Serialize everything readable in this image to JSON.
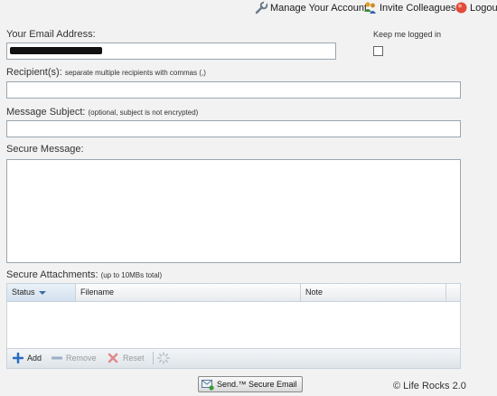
{
  "nav": {
    "manage_account": "Manage Your Account",
    "invite_colleagues": "Invite Colleagues",
    "logout": "Logout"
  },
  "email": {
    "label": "Your Email Address:",
    "value_redacted": true
  },
  "keep_logged_in": {
    "label": "Keep me logged in",
    "checked": false
  },
  "recipients": {
    "label": "Recipient(s):",
    "hint": "separate multiple recipients with commas (,)",
    "value": ""
  },
  "subject": {
    "label": "Message Subject:",
    "hint": "(optional, subject is not encrypted)",
    "value": ""
  },
  "message": {
    "label": "Secure Message:",
    "value": ""
  },
  "attachments": {
    "label": "Secure Attachments:",
    "hint": "(up to 10MBs total)",
    "columns": [
      "Status",
      "Filename",
      "Note"
    ],
    "rows": [],
    "toolbar": {
      "add": "Add",
      "remove": "Remove",
      "reset": "Reset"
    }
  },
  "send_button": "Send.™ Secure Email",
  "watermark": "© Life Rocks 2.0",
  "colors": {
    "background": "#f2f2f2",
    "border": "#9aa6b0",
    "add_icon": "#2a6bc0",
    "reset_icon": "#d9534f"
  }
}
